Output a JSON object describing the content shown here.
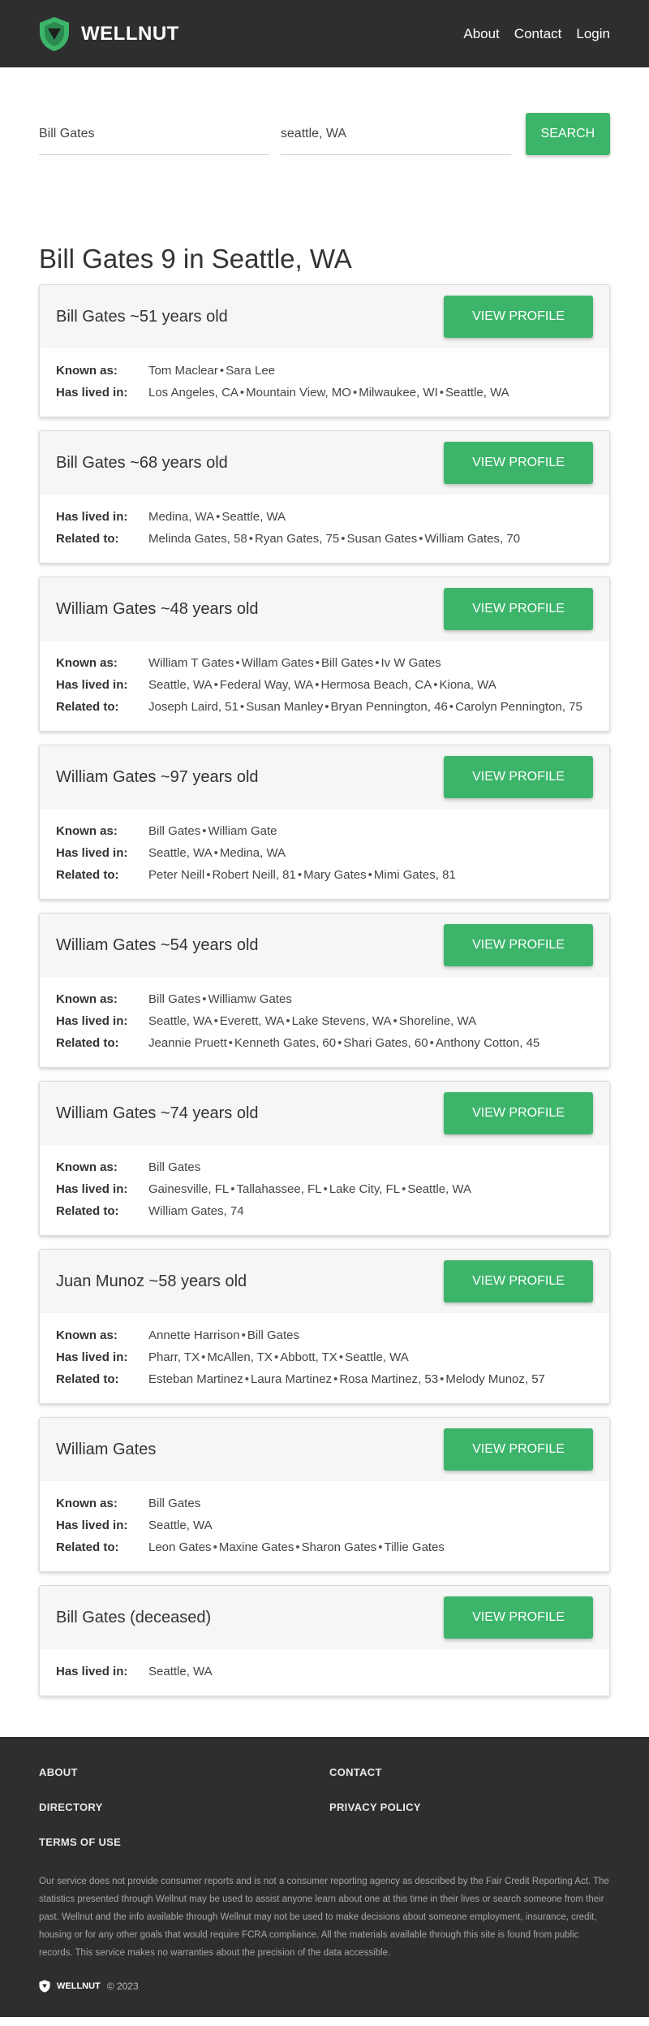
{
  "header": {
    "brand": "WELLNUT",
    "nav": [
      "About",
      "Contact",
      "Login"
    ]
  },
  "search": {
    "name_value": "Bill Gates",
    "location_value": "seattle, WA",
    "button_label": "SEARCH"
  },
  "results_title": "Bill Gates 9 in Seattle, WA",
  "view_profile_label": "VIEW PROFILE",
  "results": [
    {
      "name": "Bill Gates ~51 years old",
      "rows": [
        {
          "label": "Known as:",
          "values": [
            "Tom Maclear",
            "Sara Lee"
          ]
        },
        {
          "label": "Has lived in:",
          "values": [
            "Los Angeles, CA",
            "Mountain View, MO",
            "Milwaukee, WI",
            "Seattle, WA"
          ]
        }
      ]
    },
    {
      "name": "Bill Gates ~68 years old",
      "rows": [
        {
          "label": "Has lived in:",
          "values": [
            "Medina, WA",
            "Seattle, WA"
          ]
        },
        {
          "label": "Related to:",
          "values": [
            "Melinda Gates, 58",
            "Ryan Gates, 75",
            "Susan Gates",
            "William Gates, 70"
          ]
        }
      ]
    },
    {
      "name": "William Gates ~48 years old",
      "rows": [
        {
          "label": "Known as:",
          "values": [
            "William T Gates",
            "Willam Gates",
            "Bill Gates",
            "Iv W Gates"
          ]
        },
        {
          "label": "Has lived in:",
          "values": [
            "Seattle, WA",
            "Federal Way, WA",
            "Hermosa Beach, CA",
            "Kiona, WA"
          ]
        },
        {
          "label": "Related to:",
          "values": [
            "Joseph Laird, 51",
            "Susan Manley",
            "Bryan Pennington, 46",
            "Carolyn Pennington, 75"
          ]
        }
      ]
    },
    {
      "name": "William Gates ~97 years old",
      "rows": [
        {
          "label": "Known as:",
          "values": [
            "Bill Gates",
            "William Gate"
          ]
        },
        {
          "label": "Has lived in:",
          "values": [
            "Seattle, WA",
            "Medina, WA"
          ]
        },
        {
          "label": "Related to:",
          "values": [
            "Peter Neill",
            "Robert Neill, 81",
            "Mary Gates",
            "Mimi Gates, 81"
          ]
        }
      ]
    },
    {
      "name": "William Gates ~54 years old",
      "rows": [
        {
          "label": "Known as:",
          "values": [
            "Bill Gates",
            "Williamw Gates"
          ]
        },
        {
          "label": "Has lived in:",
          "values": [
            "Seattle, WA",
            "Everett, WA",
            "Lake Stevens, WA",
            "Shoreline, WA"
          ]
        },
        {
          "label": "Related to:",
          "values": [
            "Jeannie Pruett",
            "Kenneth Gates, 60",
            "Shari Gates, 60",
            "Anthony Cotton, 45"
          ]
        }
      ]
    },
    {
      "name": "William Gates ~74 years old",
      "rows": [
        {
          "label": "Known as:",
          "values": [
            "Bill Gates"
          ]
        },
        {
          "label": "Has lived in:",
          "values": [
            "Gainesville, FL",
            "Tallahassee, FL",
            "Lake City, FL",
            "Seattle, WA"
          ]
        },
        {
          "label": "Related to:",
          "values": [
            "William Gates, 74"
          ]
        }
      ]
    },
    {
      "name": "Juan Munoz ~58 years old",
      "rows": [
        {
          "label": "Known as:",
          "values": [
            "Annette Harrison",
            "Bill Gates"
          ]
        },
        {
          "label": "Has lived in:",
          "values": [
            "Pharr, TX",
            "McAllen, TX",
            "Abbott, TX",
            "Seattle, WA"
          ]
        },
        {
          "label": "Related to:",
          "values": [
            "Esteban Martinez",
            "Laura Martinez",
            "Rosa Martinez, 53",
            "Melody Munoz, 57"
          ]
        }
      ]
    },
    {
      "name": "William Gates",
      "rows": [
        {
          "label": "Known as:",
          "values": [
            "Bill Gates"
          ]
        },
        {
          "label": "Has lived in:",
          "values": [
            "Seattle, WA"
          ]
        },
        {
          "label": "Related to:",
          "values": [
            "Leon Gates",
            "Maxine Gates",
            "Sharon Gates",
            "Tillie Gates"
          ]
        }
      ]
    },
    {
      "name": "Bill Gates (deceased)",
      "rows": [
        {
          "label": "Has lived in:",
          "values": [
            "Seattle, WA"
          ]
        }
      ]
    }
  ],
  "footer": {
    "links": [
      "ABOUT",
      "CONTACT",
      "DIRECTORY",
      "PRIVACY POLICY",
      "TERMS OF USE"
    ],
    "disclaimer": "Our service does not provide consumer reports and is not a consumer reporting agency as described by the Fair Credit Reporting Act. The statistics presented through Wellnut may be used to assist anyone learn about one at this time in their lives or search someone from their past. Wellnut and the info available through Wellnut may not be used to make decisions about someone employment, insurance, credit, housing or for any other goals that would require FCRA compliance. All the materials available through this site is found from public records. This service makes no warranties about the precision of the data accessible.",
    "copy_brand": "WELLNUT",
    "copyright": "© 2023"
  },
  "colors": {
    "accent": "#3cb56a",
    "header_bg": "#2e2e2e",
    "card_head_bg": "#f6f6f6"
  },
  "icons": {
    "brand_logo": "shield-logo-icon"
  }
}
